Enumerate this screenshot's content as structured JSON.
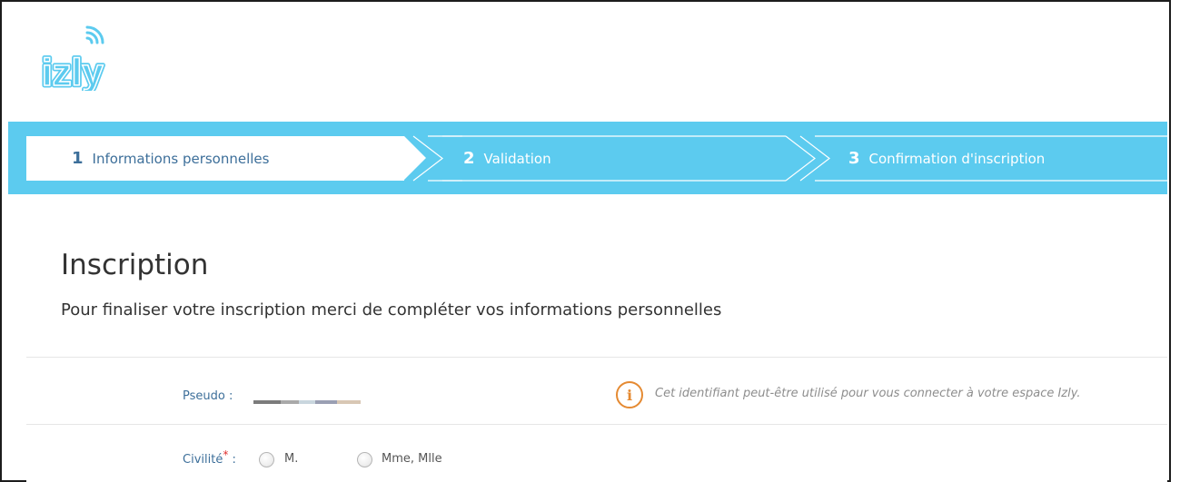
{
  "logo": {
    "text": "izly"
  },
  "steps": [
    {
      "number": "1",
      "label": "Informations personnelles"
    },
    {
      "number": "2",
      "label": "Validation"
    },
    {
      "number": "3",
      "label": "Confirmation d'inscription"
    }
  ],
  "page": {
    "title": "Inscription",
    "subtitle": "Pour finaliser votre inscription merci de compléter vos informations personnelles"
  },
  "form": {
    "pseudo_label": "Pseudo :",
    "pseudo_info": "Cet identifiant peut-être utilisé pour vous connecter à votre espace Izly.",
    "civilite_label": "Civilité",
    "civilite_suffix": " :",
    "required_mark": "*",
    "civilite_options": [
      "M.",
      "Mme, Mlle"
    ]
  },
  "colors": {
    "accent": "#5ccbef",
    "label": "#3d6f9a",
    "info": "#e58a32",
    "logo": "#5ccbef"
  },
  "icons": {
    "info": "info-icon",
    "signal": "wifi-signal-icon"
  }
}
